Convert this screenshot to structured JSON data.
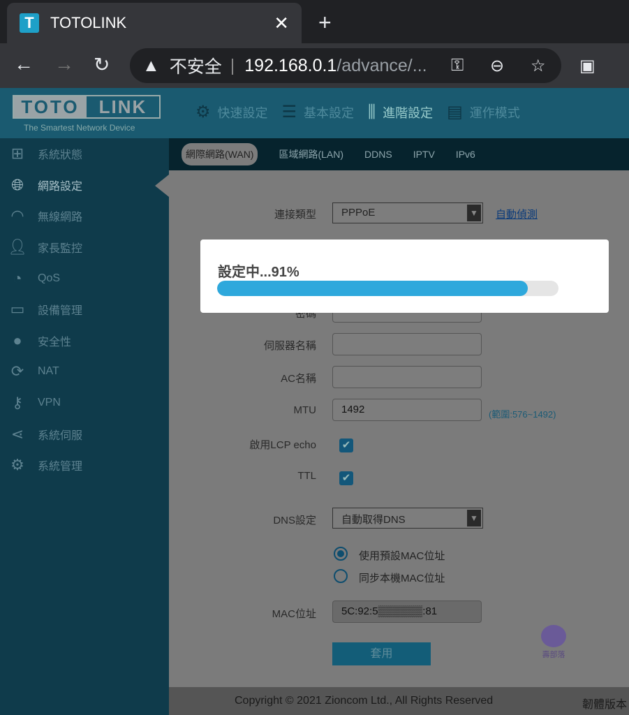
{
  "browser": {
    "tab_title": "TOTOLINK",
    "favicon": "T",
    "close": "✕",
    "new_tab": "+",
    "insecure_label": "不安全",
    "url_host": "192.168.0.1",
    "url_path": "/advance/..."
  },
  "header": {
    "logo_left": "TOTO",
    "logo_right": "LINK",
    "slogan": "The Smartest Network Device",
    "nav": [
      {
        "label": "快速設定",
        "icon": "gear-icon"
      },
      {
        "label": "基本設定",
        "icon": "list-icon"
      },
      {
        "label": "進階設定",
        "icon": "sliders-icon"
      },
      {
        "label": "運作模式",
        "icon": "mode-icon"
      }
    ],
    "active_nav": "進階設定"
  },
  "sidebar": {
    "items": [
      {
        "label": "系統狀態",
        "icon": "network-status-icon"
      },
      {
        "label": "網路設定",
        "icon": "globe-icon"
      },
      {
        "label": "無線網路",
        "icon": "wifi-icon"
      },
      {
        "label": "家長監控",
        "icon": "parental-icon"
      },
      {
        "label": "QoS",
        "icon": "gauge-icon"
      },
      {
        "label": "設備管理",
        "icon": "devices-icon"
      },
      {
        "label": "安全性",
        "icon": "lock-icon"
      },
      {
        "label": "NAT",
        "icon": "refresh-icon"
      },
      {
        "label": "VPN",
        "icon": "key-icon"
      },
      {
        "label": "系統伺服",
        "icon": "share-icon"
      },
      {
        "label": "系統管理",
        "icon": "settings-icon"
      }
    ],
    "active": "網路設定"
  },
  "subtabs": [
    {
      "label": "網際網路(WAN)",
      "active": true
    },
    {
      "label": "區域網路(LAN)"
    },
    {
      "label": "DDNS"
    },
    {
      "label": "IPTV"
    },
    {
      "label": "IPv6"
    }
  ],
  "form": {
    "conn_type_label": "連接類型",
    "conn_type_value": "PPPoE",
    "auto_detect": "自動偵測",
    "password_label": "密碼",
    "server_name_label": "伺服器名稱",
    "server_name_value": "",
    "ac_name_label": "AC名稱",
    "ac_name_value": "",
    "mtu_label": "MTU",
    "mtu_value": "1492",
    "mtu_hint": "(範圍:576~1492)",
    "lcp_label": "啟用LCP echo",
    "lcp_checked": true,
    "ttl_label": "TTL",
    "ttl_checked": true,
    "dns_label": "DNS設定",
    "dns_value": "自動取得DNS",
    "mac_option1": "使用預設MAC位址",
    "mac_option2": "同步本機MAC位址",
    "mac_selected": 1,
    "mac_label": "MAC位址",
    "mac_value": "5C:92:5▒▒▒▒▒▒:81",
    "apply": "套用"
  },
  "modal": {
    "text": "設定中...91%",
    "progress": 91,
    "color": "#2ea8dc"
  },
  "footer": {
    "copyright": "Copyright © 2021 Zioncom Ltd., All Rights Reserved",
    "version": "韌體版本"
  },
  "watermark": "壽部落"
}
